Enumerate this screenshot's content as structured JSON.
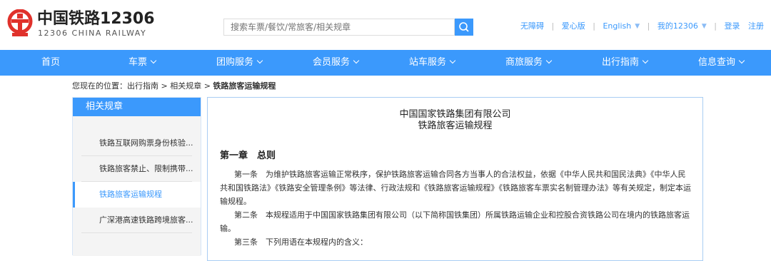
{
  "header": {
    "brand_cn": "中国铁路12306",
    "brand_en": "12306 CHINA RAILWAY",
    "search_placeholder": "搜索车票/餐饮/常旅客/相关规章",
    "links": {
      "accessible": "无障碍",
      "care": "爱心版",
      "language": "English",
      "my12306": "我的12306",
      "login": "登录",
      "register": "注册"
    }
  },
  "nav": {
    "items": [
      "首页",
      "车票",
      "团购服务",
      "会员服务",
      "站车服务",
      "商旅服务",
      "出行指南",
      "信息查询"
    ]
  },
  "breadcrumb": {
    "prefix": "您现在的位置：出行指南 > 相关规章 > ",
    "current": "铁路旅客运输规程"
  },
  "sidebar": {
    "title": "相关规章",
    "items": [
      "铁路互联网购票身份核验...",
      "铁路旅客禁止、限制携带...",
      "铁路旅客运输规程",
      "广深港高速铁路跨境旅客..."
    ],
    "active_index": 2
  },
  "content": {
    "org": "中国国家铁路集团有限公司",
    "title": "铁路旅客运输规程",
    "chapter": "第一章　总则",
    "paragraphs": [
      "第一条　为维护铁路旅客运输正常秩序，保护铁路旅客运输合同各方当事人的合法权益，依据《中华人民共和国民法典》《中华人民共和国铁路法》《铁路安全管理条例》等法律、行政法规和《铁路旅客运输规程》《铁路旅客车票实名制管理办法》等有关规定，制定本运输规程。",
      "第二条　本规程适用于中国国家铁路集团有限公司（以下简称国铁集团）所属铁路运输企业和控股合资铁路公司在境内的铁路旅客运输。",
      "第三条　下列用语在本规程内的含义："
    ]
  },
  "colors": {
    "brand_blue": "#3b99fc",
    "logo_red": "#e0312b"
  }
}
